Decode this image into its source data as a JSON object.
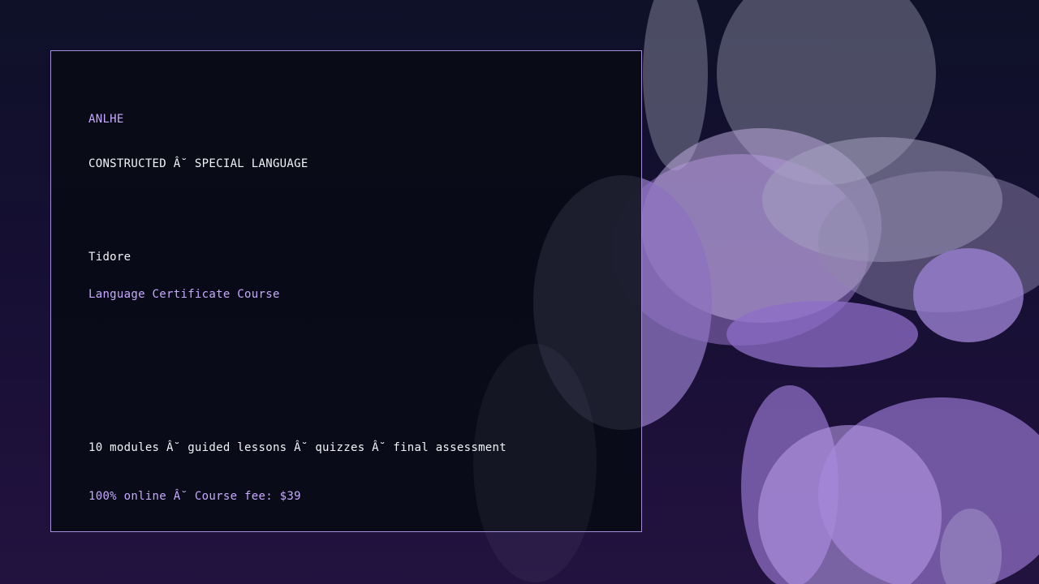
{
  "brand": "ANLHE",
  "subtitle": "CONSTRUCTED Â˘ SPECIAL LANGUAGE",
  "course_name": "Tidore",
  "course_type": "Language Certificate Course",
  "details": "10 modules Â˘ guided lessons Â˘ quizzes Â˘ final assessment",
  "pricing": "100% online Â˘ Course fee: $39",
  "colors": {
    "accent": "#c8a9ff",
    "text": "#f2f2f7",
    "card_border": "#a48fd8",
    "card_background": "#080b16"
  }
}
